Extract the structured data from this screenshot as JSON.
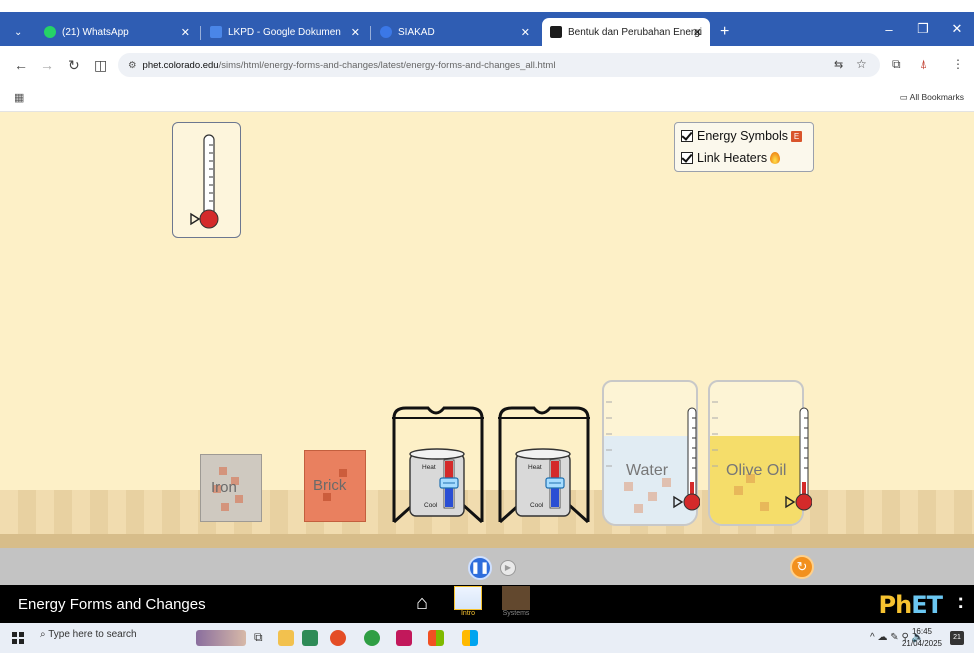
{
  "browser": {
    "tabs": [
      {
        "label": "(21) WhatsApp",
        "favicon_color": "#25d366"
      },
      {
        "label": "LKPD - Google Dokumen",
        "favicon_color": "#4a86e8"
      },
      {
        "label": "SIAKAD",
        "favicon_color": "#3b78e7"
      },
      {
        "label": "Bentuk dan Perubahan Energi",
        "favicon_color": "#1c1c1c",
        "active": true
      }
    ],
    "new_tab_label": "+",
    "url_domain": "phet.colorado.edu",
    "url_path": "/sims/html/energy-forms-and-changes/latest/energy-forms-and-changes_all.html",
    "all_bookmarks_label": "All Bookmarks"
  },
  "sim": {
    "checkbox_panel": {
      "energy_symbols_label": "Energy Symbols",
      "energy_symbols_checked": true,
      "link_heaters_label": "Link Heaters",
      "link_heaters_checked": true,
      "energy_symbol_glyph": "E"
    },
    "blocks": [
      {
        "label": "Iron",
        "color": "#c7c1b8"
      },
      {
        "label": "Brick",
        "color": "#e07a58"
      }
    ],
    "burners": [
      {
        "heat_label": "Heat",
        "cool_label": "Cool"
      },
      {
        "heat_label": "Heat",
        "cool_label": "Cool"
      }
    ],
    "beakers": [
      {
        "label": "Water",
        "liquid_color": "#dde8f0"
      },
      {
        "label": "Olive Oil",
        "liquid_color": "#f5dd6a"
      }
    ],
    "title": "Energy Forms and Changes",
    "screens": [
      {
        "label": "Intro",
        "selected": true
      },
      {
        "label": "Systems",
        "selected": false
      }
    ],
    "logo_text_ph": "PhET",
    "logo_menu": ":"
  },
  "taskbar": {
    "search_placeholder": "Type here to search",
    "time": "16:45",
    "date": "21/04/2025",
    "notification_count": "21"
  }
}
